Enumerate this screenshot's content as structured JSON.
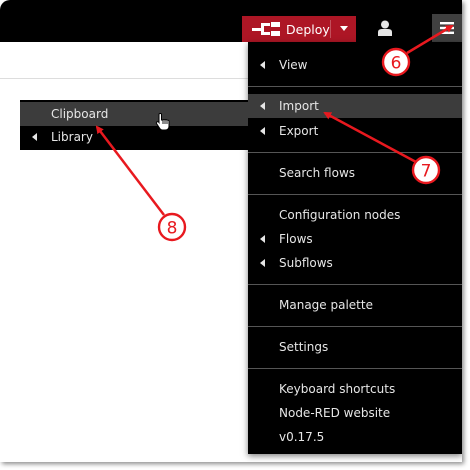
{
  "header": {
    "deploy_label": "Deploy"
  },
  "main_menu": {
    "items": [
      {
        "label": "View"
      },
      {
        "label": "Import"
      },
      {
        "label": "Export"
      },
      {
        "label": "Search flows"
      },
      {
        "label": "Configuration nodes"
      },
      {
        "label": "Flows"
      },
      {
        "label": "Subflows"
      },
      {
        "label": "Manage palette"
      },
      {
        "label": "Settings"
      },
      {
        "label": "Keyboard shortcuts"
      },
      {
        "label": "Node-RED website"
      },
      {
        "label": "v0.17.5"
      }
    ]
  },
  "import_submenu": {
    "items": [
      {
        "label": "Clipboard"
      },
      {
        "label": "Library"
      }
    ]
  },
  "callouts": [
    {
      "number": "6"
    },
    {
      "number": "7"
    },
    {
      "number": "8"
    }
  ],
  "colors": {
    "deploy_red": "#ad1625",
    "menu_bg": "#000000",
    "menu_active": "#3c3c3c",
    "annotation_red": "#e8191f"
  },
  "icons": {
    "deploy": "deploy-flow-icon",
    "user": "user-icon",
    "menu": "hamburger-menu-icon",
    "submenu_indicator": "caret-left-icon",
    "pointer": "hand-pointer-icon"
  }
}
